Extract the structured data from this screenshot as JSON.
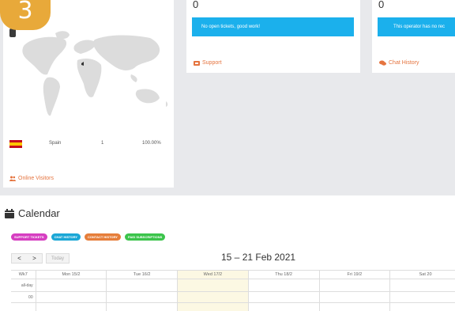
{
  "step_badge": "3",
  "online_visitors": {
    "rows": [
      {
        "flag": "spain-flag",
        "country": "Spain",
        "count": "1",
        "percent": "100.00%"
      }
    ],
    "footer_label": "Online Visitors",
    "footer_icon": "users-icon"
  },
  "support": {
    "count": "0",
    "message": "No open tickets, good work!",
    "footer_label": "Support",
    "footer_icon": "ticket-icon"
  },
  "chat": {
    "count": "0",
    "message": "This operator has no rec",
    "footer_label": "Chat History",
    "footer_icon": "chat-icon"
  },
  "calendar": {
    "title": "Calendar",
    "icon": "calendar-icon",
    "legend": [
      {
        "label": "SUPPORT TICKETS",
        "color": "#d63ec1"
      },
      {
        "label": "CHAT HISTORY",
        "color": "#1ba7d6"
      },
      {
        "label": "CONTACT HISTORY",
        "color": "#e67e3a"
      },
      {
        "label": "PAID SUBSCRIPTIONS",
        "color": "#3bc44b"
      }
    ],
    "prev": "<",
    "next": ">",
    "today": "Today",
    "range": "15 – 21 Feb 2021",
    "columns": [
      "Wk7",
      "Mon 15/2",
      "Tue 16/2",
      "Wed 17/2",
      "Thu 18/2",
      "Fri 19/2",
      "Sat 20"
    ],
    "today_column": "Wed 17/2",
    "all_day": "all-day",
    "first_hour": "00"
  },
  "colors": {
    "accent": "#e5743f",
    "info": "#1bb0ec",
    "badge": "#e8a93a",
    "today_highlight": "#fcf8e3"
  }
}
